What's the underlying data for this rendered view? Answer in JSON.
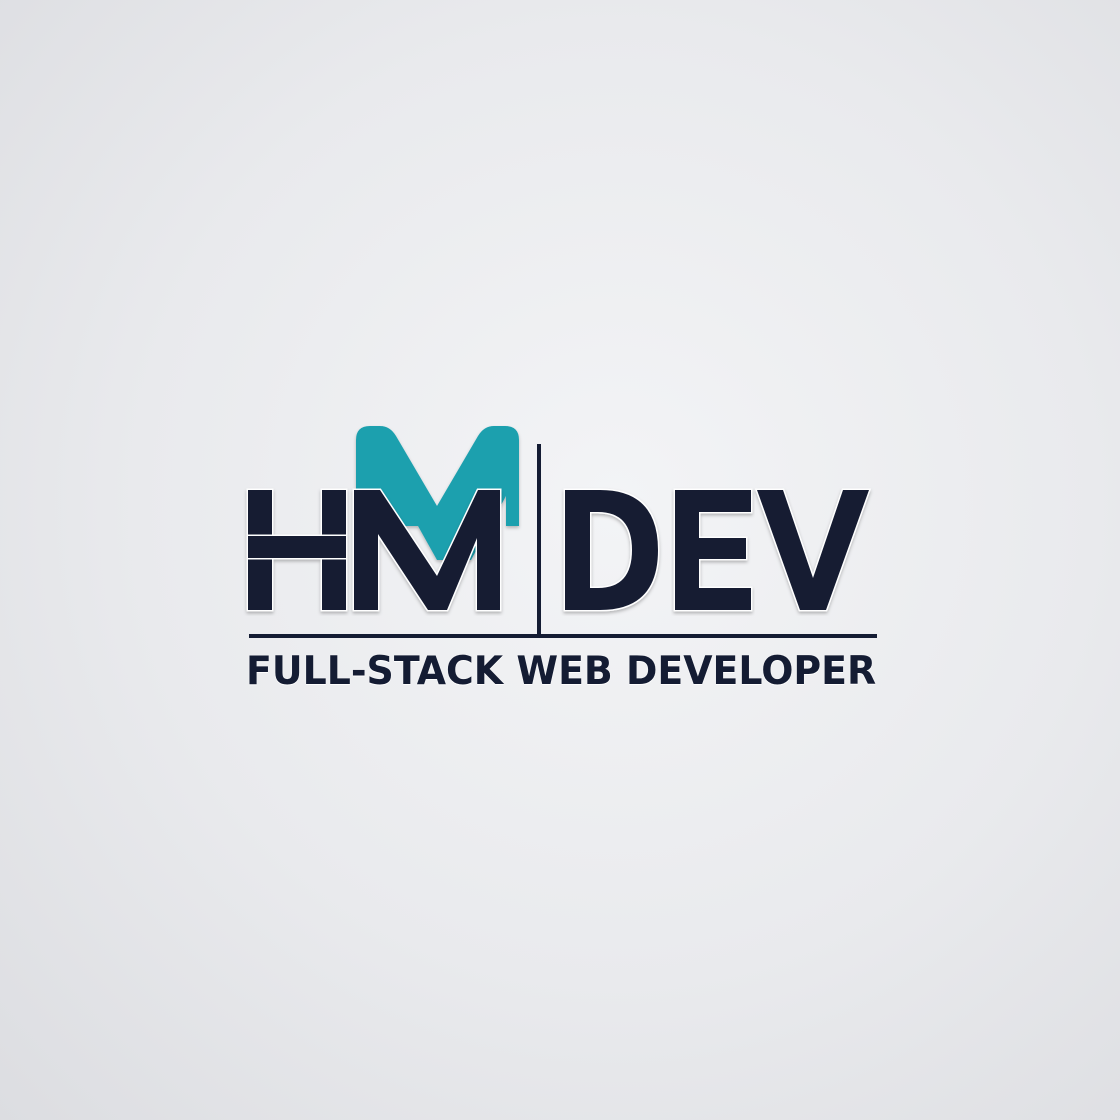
{
  "logo": {
    "wordmark_left": "HM",
    "wordmark_right": "DEV",
    "tagline": "FULL-STACK WEB DEVELOPER"
  },
  "colors": {
    "navy": "#141c33",
    "teal": "#1ea0ae",
    "background": "#e9eaed"
  }
}
